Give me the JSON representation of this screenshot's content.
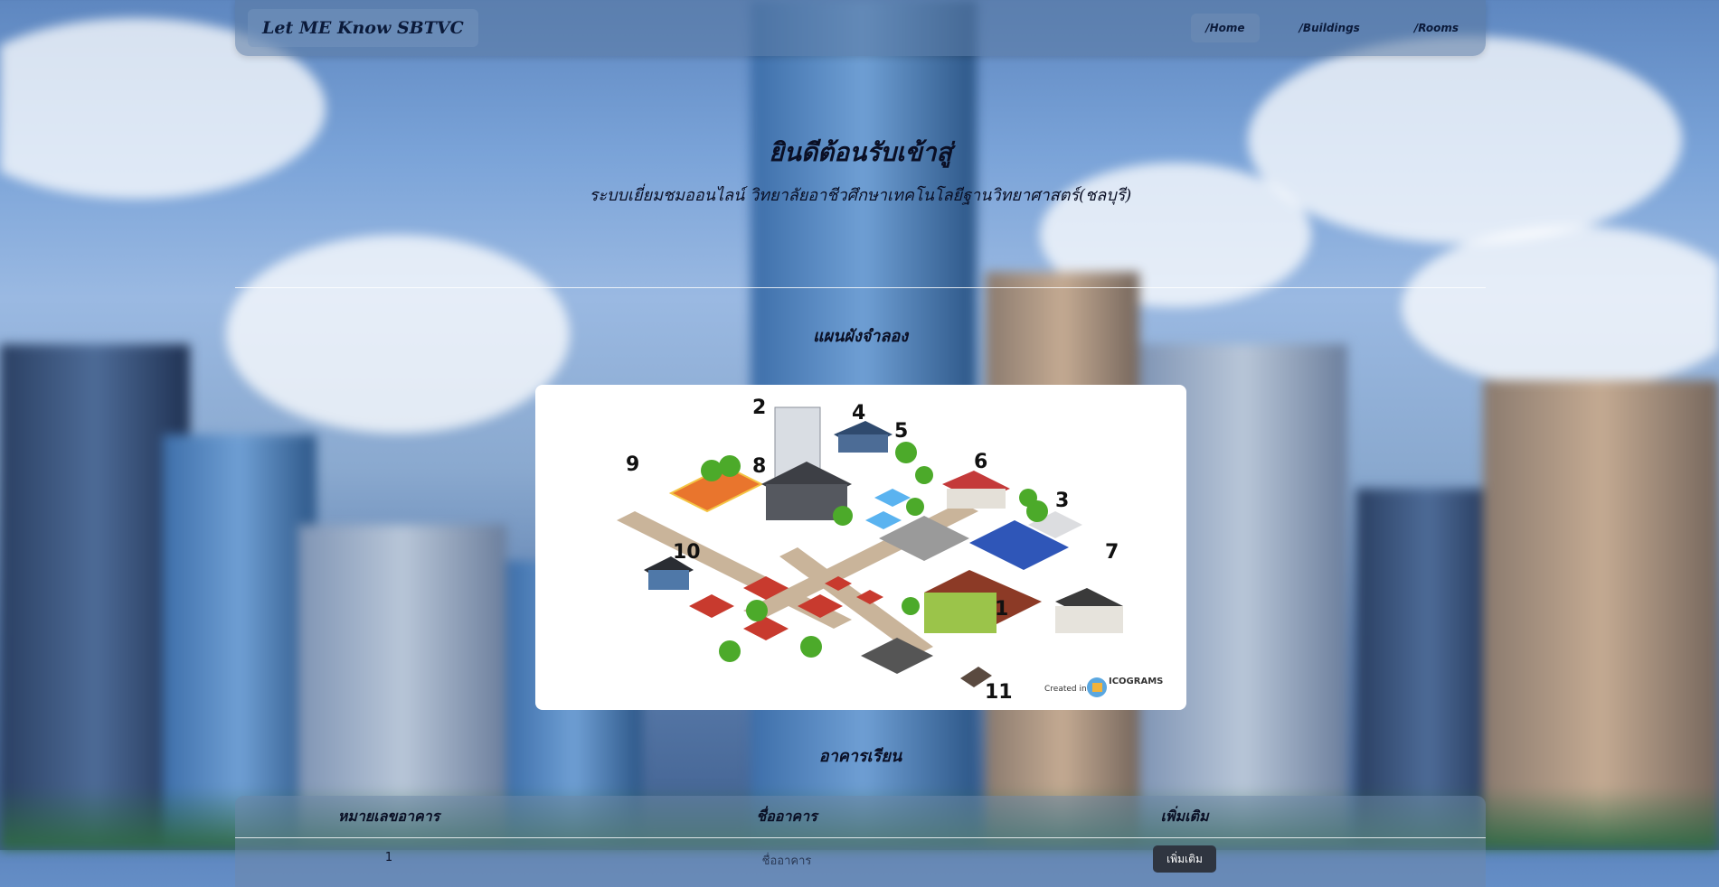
{
  "navbar": {
    "brand": "Let ME Know SBTVC",
    "links": [
      {
        "label": "/Home",
        "active": true
      },
      {
        "label": "/Buildings",
        "active": false
      },
      {
        "label": "/Rooms",
        "active": false
      }
    ]
  },
  "hero": {
    "title": "ยินดีต้อนรับเข้าสู่",
    "subtitle": "ระบบเยี่ยมชมออนไลน์ วิทยาลัยอาชีวศึกษาเทคโนโลยีฐานวิทยาศาสตร์(ชลบุรี)"
  },
  "map_section": {
    "title": "แผนผังจำลอง",
    "watermark_prefix": "Created in",
    "watermark_brand": "ICOGRAMS",
    "building_numbers": [
      "1",
      "2",
      "3",
      "4",
      "5",
      "6",
      "7",
      "8",
      "9",
      "10",
      "11"
    ]
  },
  "buildings_section": {
    "title": "อาคารเรียน",
    "columns": [
      "หมายเลขอาคาร",
      "ชื่ออาคาร",
      "เพิ่มเติม"
    ],
    "first_row": {
      "number": "1",
      "name": "ชื่ออาคาร",
      "action": "เพิ่มเติม"
    }
  },
  "colors": {
    "navbar_bg": "#5a78a0",
    "text_dark": "#0a0f25",
    "map_card_bg": "#ffffff",
    "button_dark": "#2f3540"
  }
}
